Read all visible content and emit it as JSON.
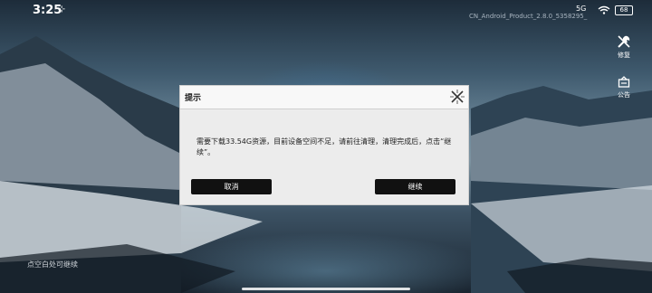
{
  "status_bar": {
    "time": "3:25",
    "indicator": "⊹",
    "signal_label": "5G",
    "battery": "68"
  },
  "version_text": "CN_Android_Product_2.8.0_5358295_",
  "side_buttons": {
    "repair_label": "修复",
    "notice_label": "公告"
  },
  "hint_text": "点空白处可继续",
  "dialog": {
    "title": "提示",
    "message": "需要下载33.54G资源，目前设备空间不足，请前往清理，清理完成后，点击“继续”。",
    "cancel_label": "取消",
    "continue_label": "继续"
  },
  "colors": {
    "dialog_bg": "#ececec",
    "button_bg": "#111111",
    "button_text": "#ffffff"
  }
}
